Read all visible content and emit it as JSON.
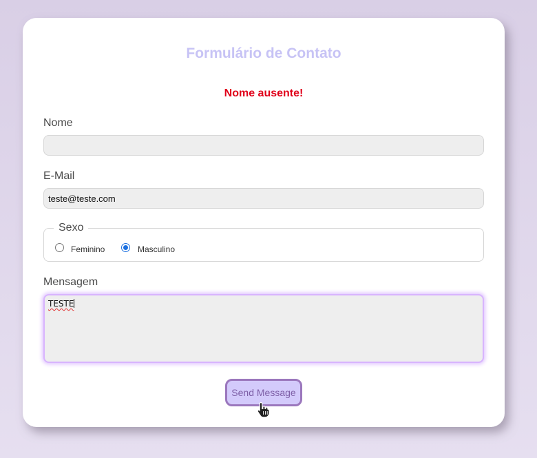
{
  "form": {
    "title": "Formulário de Contato",
    "error_message": "Nome ausente!",
    "name_label": "Nome",
    "name_value": "",
    "email_label": "E-Mail",
    "email_value": "teste@teste.com",
    "sexo_legend": "Sexo",
    "sexo_options": [
      {
        "label": "Feminino",
        "checked": false
      },
      {
        "label": "Masculino",
        "checked": true
      }
    ],
    "message_label": "Mensagem",
    "message_value": "TESTE",
    "send_label": "Send Message"
  },
  "colors": {
    "title": "#c7c3f5",
    "error": "#e0001a",
    "button_bg": "#d3cafb",
    "button_border": "#9b77bd",
    "radio_accent": "#1a6fe0"
  },
  "icons": {
    "cursor": "hand-pointer-icon"
  }
}
